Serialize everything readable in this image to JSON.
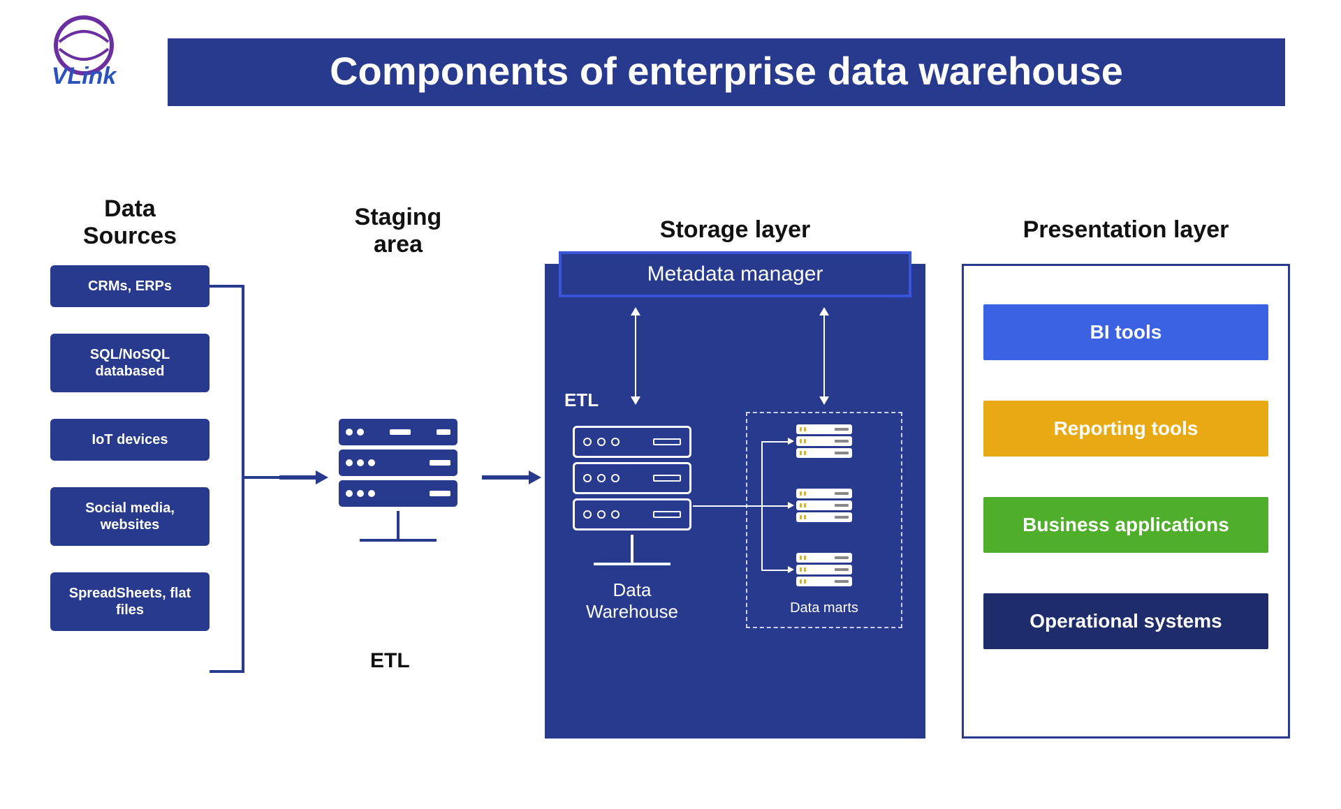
{
  "title": "Components of enterprise data warehouse",
  "logo_text": "VLink",
  "columns": {
    "data_sources": "Data\nSources",
    "staging": "Staging\narea",
    "storage": "Storage layer",
    "presentation": "Presentation layer"
  },
  "data_sources": [
    "CRMs, ERPs",
    "SQL/NoSQL databased",
    "IoT devices",
    "Social media, websites",
    "SpreadSheets, flat files"
  ],
  "staging_label": "ETL",
  "storage": {
    "metadata_manager": "Metadata manager",
    "etl_label": "ETL",
    "data_warehouse_label": "Data\nWarehouse",
    "data_marts_label": "Data marts"
  },
  "presentation": [
    {
      "label": "BI tools",
      "color": "#3a62e3"
    },
    {
      "label": "Reporting tools",
      "color": "#e9a912"
    },
    {
      "label": "Business applications",
      "color": "#4fae2a"
    },
    {
      "label": "Operational systems",
      "color": "#1e2c6b"
    }
  ],
  "colors": {
    "brand_navy": "#283a8e",
    "brand_blue": "#3a55d9"
  }
}
